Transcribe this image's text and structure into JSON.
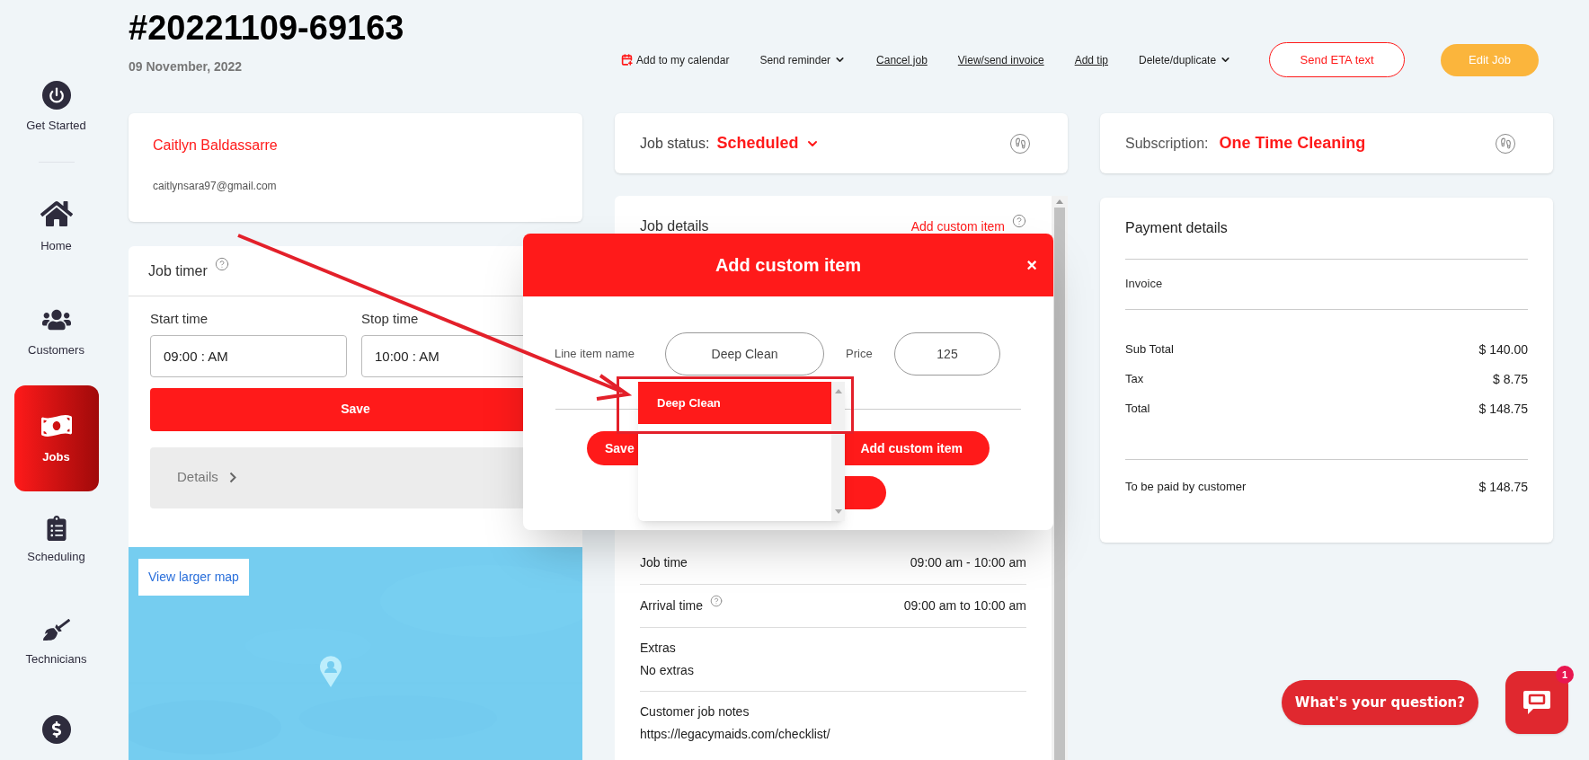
{
  "sidebar": {
    "items": [
      {
        "label": "Get Started",
        "selected": false
      },
      {
        "label": "Home",
        "selected": false
      },
      {
        "label": "Customers",
        "selected": false
      },
      {
        "label": "Jobs",
        "selected": true
      },
      {
        "label": "Scheduling",
        "selected": false
      },
      {
        "label": "Technicians",
        "selected": false
      },
      {
        "selected": false
      }
    ]
  },
  "header": {
    "job_number": "#20221109-69163",
    "date": "09 November, 2022",
    "actions": [
      {
        "label": "Add to my calendar",
        "kind": "icon-link"
      },
      {
        "label": "Send reminder",
        "kind": "dropdown"
      },
      {
        "label": "Cancel job",
        "kind": "link"
      },
      {
        "label": "View/send invoice",
        "kind": "link"
      },
      {
        "label": "Add tip",
        "kind": "link"
      },
      {
        "label": "Delete/duplicate",
        "kind": "dropdown"
      }
    ],
    "send_eta": "Send ETA text",
    "edit_job": "Edit Job"
  },
  "customer": {
    "name": "Caitlyn Baldassarre",
    "email": "caitlynsara97@gmail.com"
  },
  "job_timer": {
    "title": "Job timer",
    "start_label": "Start time",
    "start_value": "09:00 : AM",
    "stop_label": "Stop time",
    "stop_value": "10:00 : AM",
    "save": "Save",
    "details": "Details"
  },
  "map": {
    "kind": "picture",
    "link": "View larger map"
  },
  "job_status": {
    "label": "Job status:",
    "value": "Scheduled"
  },
  "job_details": {
    "title": "Job details",
    "add_link": "Add custom item",
    "rows": [
      {
        "kind": "inline",
        "label": "Job time",
        "value": "09:00 am - 10:00 am",
        "help": false
      },
      {
        "kind": "inline",
        "label": "Arrival time",
        "value": "09:00 am to 10:00 am",
        "help": true
      },
      {
        "kind": "stacked",
        "label": "Extras",
        "value": "No extras",
        "help": false
      },
      {
        "kind": "stacked",
        "label": "Customer job notes",
        "value": "https://legacymaids.com/checklist/",
        "help": false
      }
    ]
  },
  "subscription": {
    "label": "Subscription:",
    "value": "One Time Cleaning"
  },
  "payment": {
    "title": "Payment details",
    "invoice": "Invoice",
    "lines": [
      {
        "label": "Sub Total",
        "value": "$ 140.00"
      },
      {
        "label": "Tax",
        "value": "$ 8.75"
      },
      {
        "label": "Total",
        "value": "$ 148.75"
      }
    ],
    "due": {
      "label": "To be paid by customer",
      "value": "$ 148.75"
    }
  },
  "modal": {
    "title": "Add custom item",
    "close": "×",
    "name_label": "Line item name",
    "name_value": "Deep Clean",
    "price_label": "Price",
    "price_value": "125",
    "options": [
      {
        "label": "Deep Clean",
        "selected": true
      }
    ],
    "buttons": [
      "Save",
      "Add custom item"
    ]
  },
  "chat": {
    "prompt": "What's your question?",
    "badge": "1"
  }
}
